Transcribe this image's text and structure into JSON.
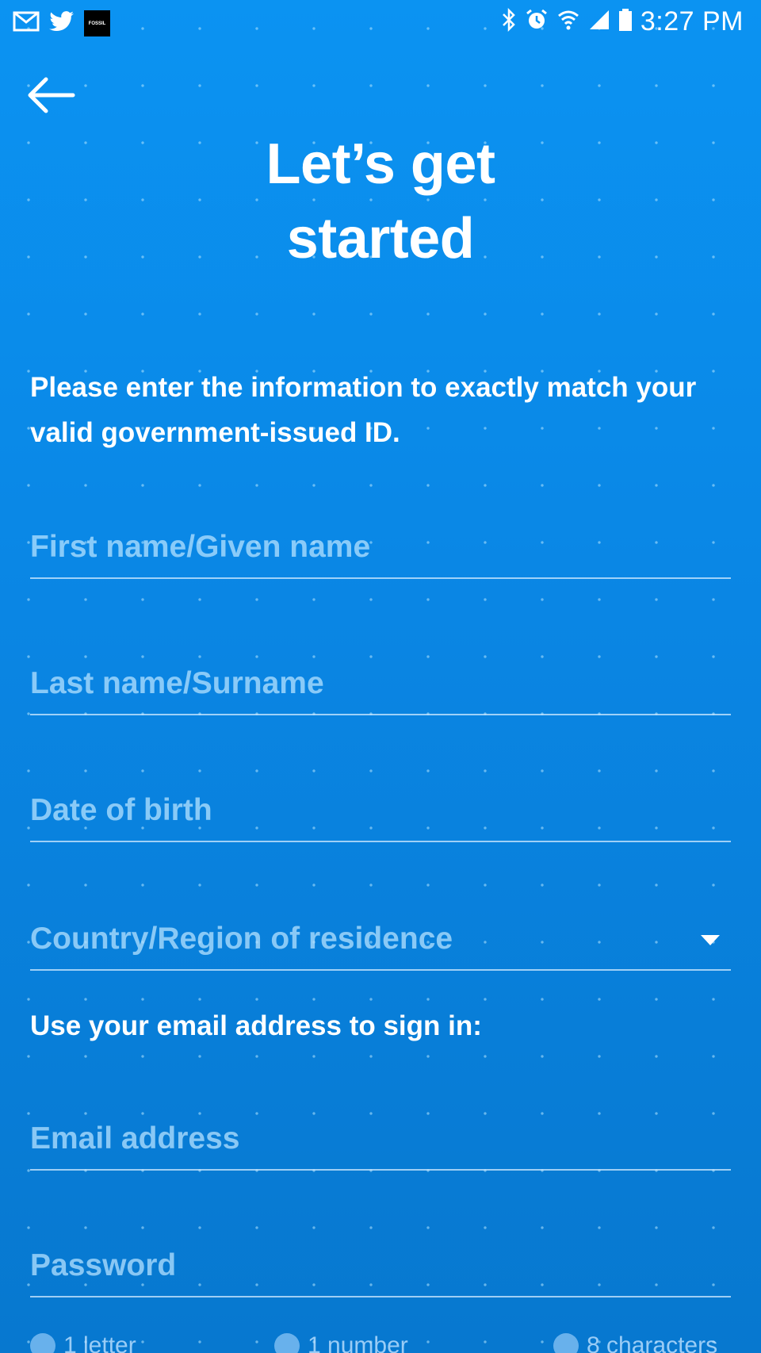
{
  "status_bar": {
    "time": "3:27 PM",
    "left_icons": [
      "email-icon",
      "twitter-icon",
      "fossil-icon"
    ],
    "fossil_label": "FOSSIL",
    "right_icons": [
      "bluetooth-icon",
      "alarm-icon",
      "wifi-icon",
      "signal-icon",
      "battery-icon"
    ]
  },
  "header": {
    "back_icon": "arrow-left-icon",
    "title": "Let’s get started"
  },
  "intro_text": "Please enter the information to exactly match your valid government-issued ID.",
  "fields": [
    {
      "placeholder": "First name/Given name",
      "value": ""
    },
    {
      "placeholder": "Last name/Surname",
      "value": ""
    },
    {
      "placeholder": "Date of birth",
      "value": ""
    },
    {
      "placeholder": "Country/Region of residence",
      "value": "",
      "icon": "caret-down-icon"
    }
  ],
  "email_section_label": "Use your email address to sign in:",
  "account_fields": [
    {
      "placeholder": "Email address",
      "value": ""
    },
    {
      "placeholder": "Password",
      "value": ""
    }
  ],
  "password_requirements": [
    "1 letter",
    "1 number",
    "8 characters"
  ],
  "colors": {
    "background_top": "#0b93f2",
    "background_bottom": "#0778cf",
    "text": "#ffffff",
    "placeholder": "#b4e1ff"
  }
}
